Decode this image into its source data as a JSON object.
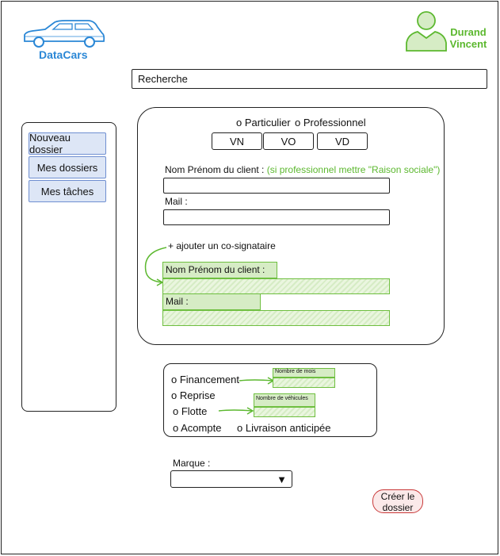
{
  "header": {
    "brand": "DataCars",
    "user_first": "Durand",
    "user_last": "Vincent",
    "brand_color": "#2a87d6",
    "accent_color": "#5cb82f"
  },
  "search": {
    "label": "Recherche"
  },
  "sidebar": {
    "items": [
      {
        "label": "Nouveau dossier"
      },
      {
        "label": "Mes dossiers"
      },
      {
        "label": "Mes tâches"
      }
    ]
  },
  "client_form": {
    "type_options": [
      "o Particulier",
      "o Professionnel"
    ],
    "tabs": [
      "VN",
      "VO",
      "VD"
    ],
    "name_label": "Nom Prénom du client :",
    "name_hint": "(si professionnel mettre \"Raison sociale\")",
    "mail_label": "Mail :",
    "add_cosigner": "+ ajouter un co-signataire",
    "cosigner_name_label": "Nom Prénom du client :",
    "cosigner_mail_label": "Mail :"
  },
  "options_form": {
    "financement": "o Financement",
    "nb_mois": "Nombre de mois",
    "reprise": "o Reprise",
    "flotte": "o Flotte",
    "nb_vehicules": "Nombre de véhicules",
    "acompte": "o Acompte",
    "livraison": "o Livraison anticipée"
  },
  "marque": {
    "label": "Marque :"
  },
  "create_button": {
    "line1": "Créer le",
    "line2": "dossier"
  }
}
